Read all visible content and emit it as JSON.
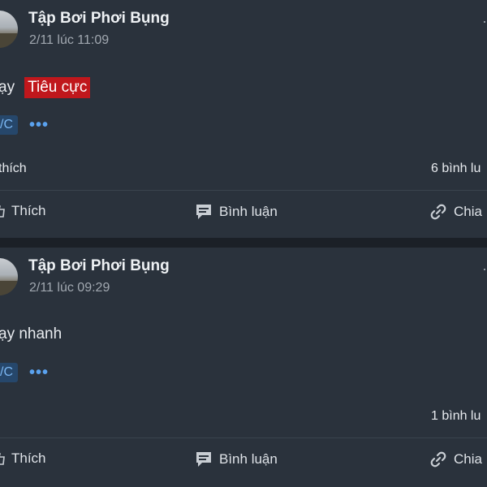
{
  "posts": [
    {
      "author": "Tập Bơi Phơi Bụng",
      "timestamp": "2/11 lúc 11:09",
      "content_text": "ạy",
      "tag_label": "Tiêu cực",
      "chip_label": "/C",
      "more_label": "•••",
      "like_summary": "thích",
      "comment_summary": "6 bình lu",
      "actions": {
        "like": "Thích",
        "comment": "Bình luận",
        "share": "Chia"
      }
    },
    {
      "author": "Tập Bơi Phơi Bụng",
      "timestamp": "2/11 lúc 09:29",
      "content_text": "ạy nhanh",
      "chip_label": "/C",
      "more_label": "•••",
      "comment_summary": "1 bình lu",
      "actions": {
        "like": "Thích",
        "comment": "Bình luận",
        "share": "Chia"
      }
    }
  ],
  "colors": {
    "card": "#2a323c",
    "separator": "#1b2027",
    "tag_negative": "#c0171c",
    "link_blue": "#5aa2ef",
    "chip_bg": "#26476b"
  },
  "icons": {
    "like": "thumbs-up-icon",
    "comment": "speech-bubble-icon",
    "share": "chain-link-icon"
  }
}
